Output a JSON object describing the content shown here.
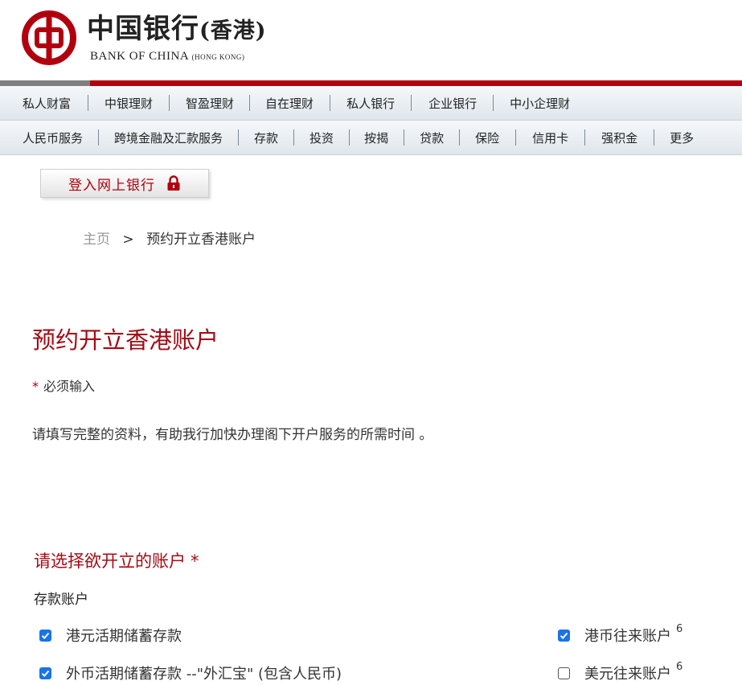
{
  "brand": {
    "logo_icon": "bank-of-china-emblem-icon",
    "name_cn_main": "中国银行",
    "name_cn_region": "(香港)",
    "name_en_main": "BANK OF CHINA",
    "name_en_region": "(HONG KONG)",
    "brand_red": "#b0000f"
  },
  "nav_primary": [
    {
      "label": "私人财富"
    },
    {
      "label": "中银理财"
    },
    {
      "label": "智盈理财"
    },
    {
      "label": "自在理财"
    },
    {
      "label": "私人银行"
    },
    {
      "label": "企业银行"
    },
    {
      "label": "中小企理财"
    }
  ],
  "nav_secondary": [
    {
      "label": "人民币服务"
    },
    {
      "label": "跨境金融及汇款服务"
    },
    {
      "label": "存款"
    },
    {
      "label": "投资"
    },
    {
      "label": "按揭"
    },
    {
      "label": "贷款"
    },
    {
      "label": "保险"
    },
    {
      "label": "信用卡"
    },
    {
      "label": "强积金"
    },
    {
      "label": "更多"
    }
  ],
  "login": {
    "label": "登入网上银行",
    "icon": "lock-icon"
  },
  "breadcrumb": {
    "home": "主页",
    "separator": ">",
    "current": "预约开立香港账户"
  },
  "main": {
    "title": "预约开立香港账户",
    "required_star": "*",
    "required_note": "必须输入",
    "intro": "请填写完整的资料，有助我行加快办理阁下开户服务的所需时间 。",
    "section_title": "请选择欲开立的账户",
    "section_star": "*",
    "subsection_title": "存款账户",
    "accounts_left": [
      {
        "label": "港元活期储蓄存款",
        "checked": true
      },
      {
        "label": "外币活期储蓄存款 --\"外汇宝\" (包含人民币)",
        "checked": true
      }
    ],
    "accounts_right": [
      {
        "label": "港币往来账户",
        "sup": "6",
        "checked": true
      },
      {
        "label": "美元往来账户",
        "sup": "6",
        "checked": false
      }
    ]
  }
}
